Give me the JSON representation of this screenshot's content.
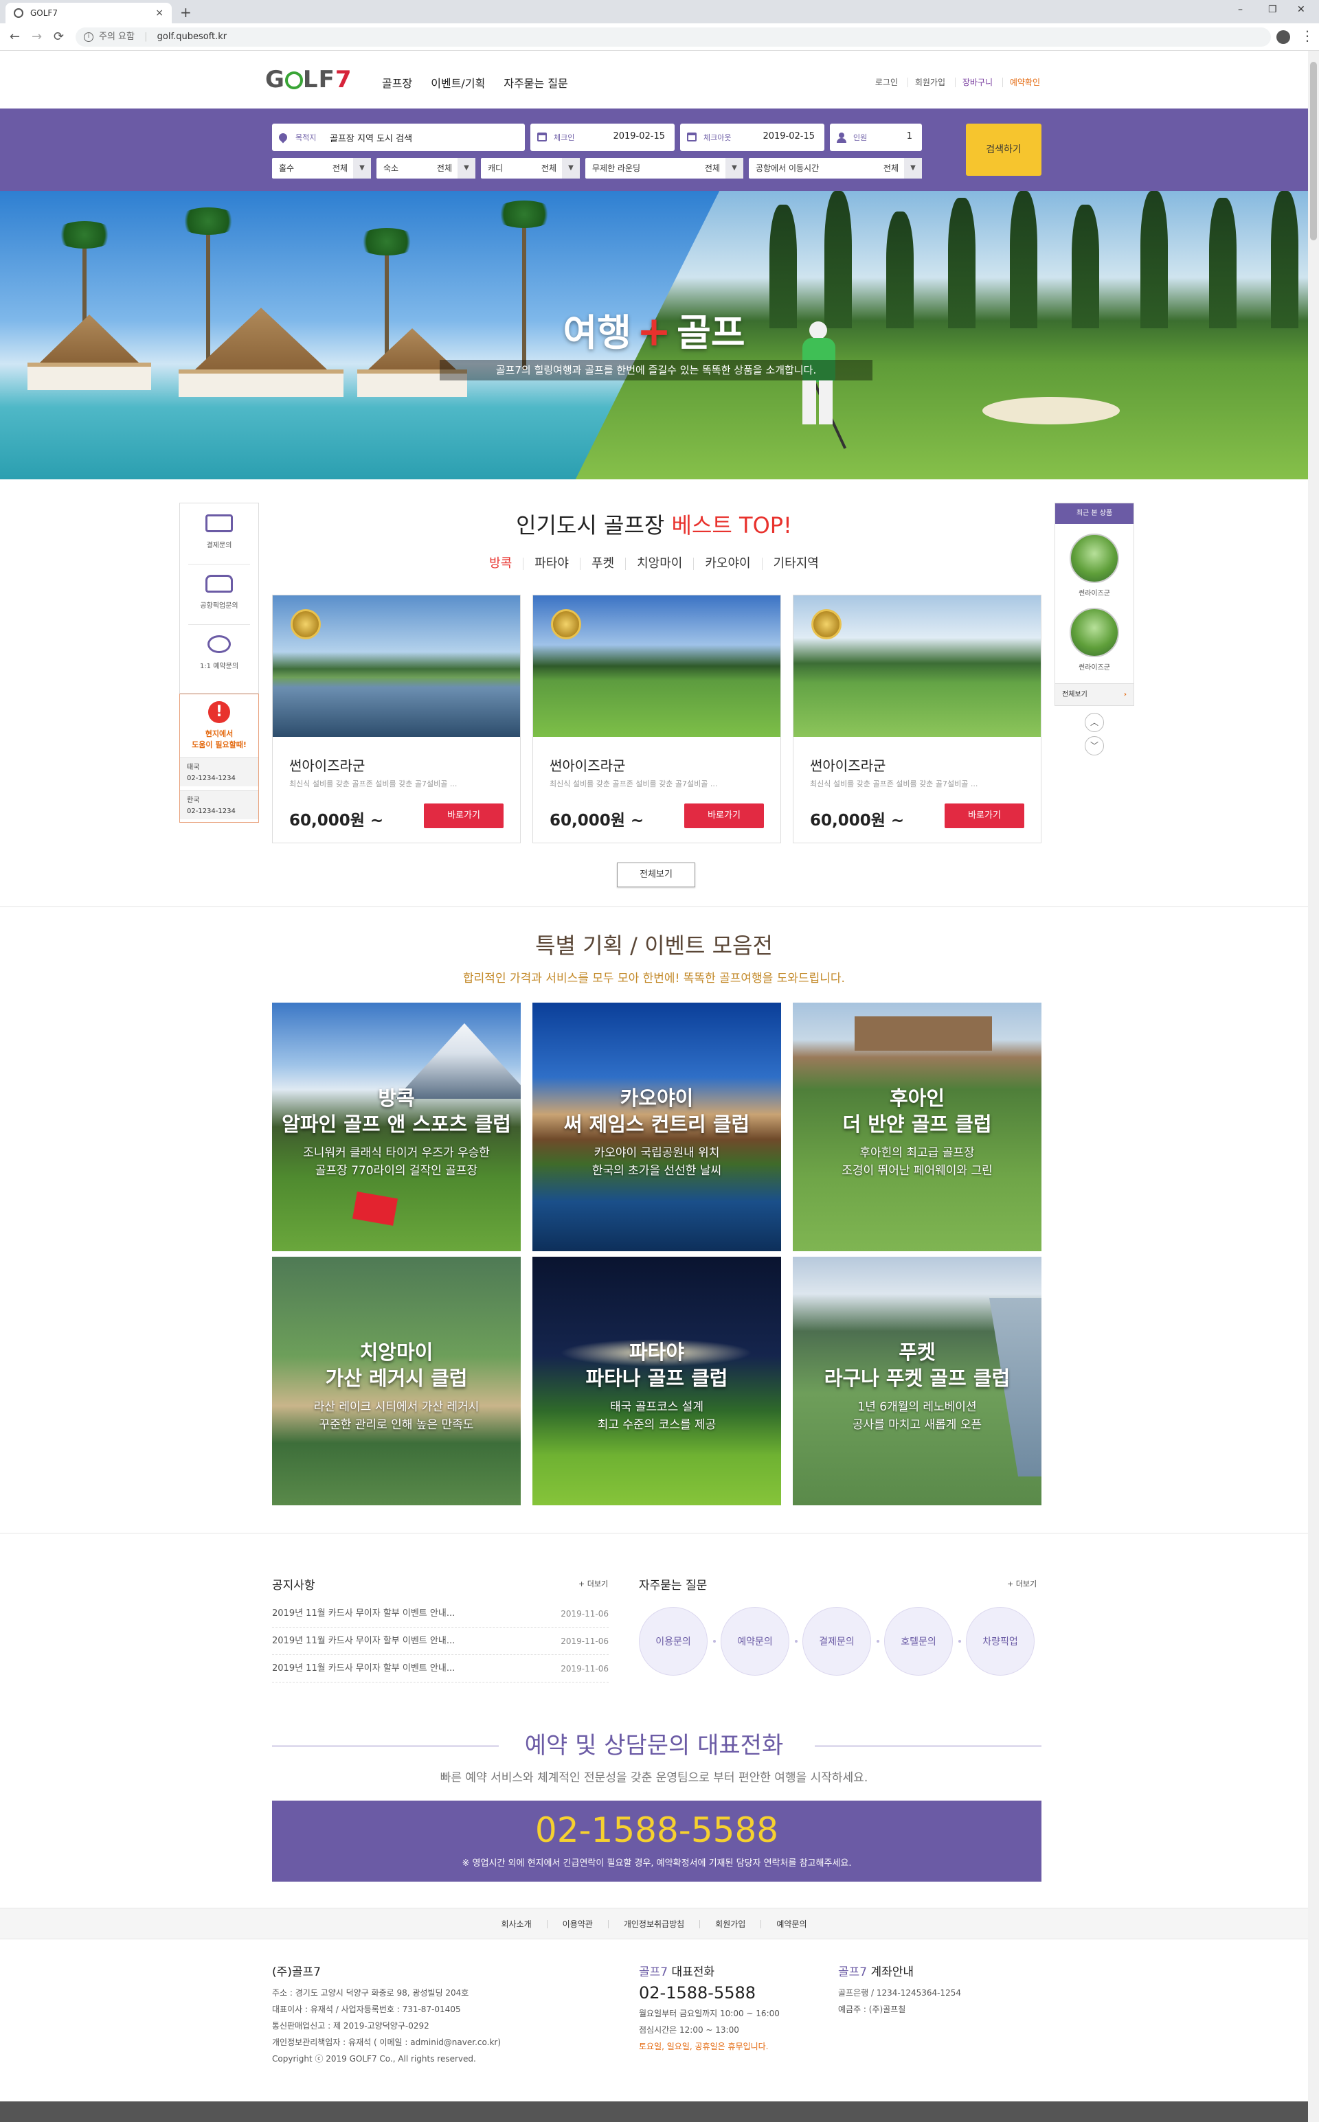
{
  "browser": {
    "tab_title": "GOLF7",
    "close": "×",
    "new_tab": "+",
    "minimize": "–",
    "maximize": "❐",
    "win_close": "✕",
    "back": "←",
    "forward": "→",
    "reload": "⟳",
    "info": "i",
    "security": "주의 요함",
    "separator": "|",
    "url": "golf.qubesoft.kr",
    "menu": "⋮"
  },
  "header": {
    "logo_go": "G",
    "logo_lf": "LF",
    "logo_7": "7",
    "nav": [
      "골프장",
      "이벤트/기획",
      "자주묻는 질문"
    ],
    "util": [
      "로그인",
      "회원가입",
      "장바구니",
      "예약확인"
    ]
  },
  "search": {
    "dest_label": "목적지",
    "dest_placeholder": "골프장 지역 도시 검색",
    "checkin_label": "체크인",
    "checkin": "2019-02-15",
    "checkout_label": "체크아웃",
    "checkout": "2019-02-15",
    "people_label": "인원",
    "people": "1",
    "filters": [
      {
        "k": "홀수",
        "v": "전체"
      },
      {
        "k": "숙소",
        "v": "전체"
      },
      {
        "k": "캐디",
        "v": "전체"
      },
      {
        "k": "무제한 라운딩",
        "v": "전체"
      },
      {
        "k": "공항에서 이동시간",
        "v": "전체"
      }
    ],
    "arrow": "▼",
    "button": "검색하기"
  },
  "hero": {
    "title_a": "여행",
    "plus": "+",
    "title_b": "골프",
    "subtitle": "골프7의 힐링여행과 골프를 한번에 즐길수 있는 똑똑한 상품을 소개합니다."
  },
  "quick": {
    "items": [
      "결제문의",
      "공항픽업문의",
      "1:1 예약문의"
    ],
    "alert": "!",
    "help_line1": "현지에서",
    "help_line2": "도움이 필요할때!",
    "contacts": [
      {
        "country": "태국",
        "phone": "02-1234-1234"
      },
      {
        "country": "한국",
        "phone": "02-1234-1234"
      }
    ]
  },
  "recent": {
    "title": "최근 본 상품",
    "items": [
      "썬라이즈군",
      "썬라이즈군"
    ],
    "all": "전체보기",
    "all_arrow": "›",
    "up": "︿",
    "down": "﹀"
  },
  "best": {
    "title_a": "인기도시 골프장",
    "title_b": "베스트 TOP!",
    "tabs": [
      "방콕",
      "파타야",
      "푸켓",
      "치앙마이",
      "카오야이",
      "기타지역"
    ],
    "cards": [
      {
        "name": "썬아이즈라군",
        "desc": "최신식 설비를 갖춘 골프존 설비를 갖춘 골7설비골 ...",
        "price": "60,000원 ~",
        "button": "바로가기"
      },
      {
        "name": "썬아이즈라군",
        "desc": "최신식 설비를 갖춘 골프존 설비를 갖춘 골7설비골 ...",
        "price": "60,000원 ~",
        "button": "바로가기"
      },
      {
        "name": "썬아이즈라군",
        "desc": "최신식 설비를 갖춘 골프존 설비를 갖춘 골7설비골 ...",
        "price": "60,000원 ~",
        "button": "바로가기"
      }
    ],
    "all_button": "전체보기"
  },
  "events": {
    "title": "특별 기획 / 이벤트 모음전",
    "subtitle": "합리적인 가격과 서비스를 모두 모아 한번에! 똑똑한 골프여행을 도와드립니다.",
    "items": [
      {
        "t1": "방콕",
        "t2": "알파인 골프 앤 스포츠 클럽",
        "d1": "조니워커 클래식 타이거 우즈가 우승한",
        "d2": "골프장 770라이의 걸작인 골프장"
      },
      {
        "t1": "카오야이",
        "t2": "써 제임스 컨트리 클럽",
        "d1": "카오야이 국립공원내 위치",
        "d2": "한국의 초가을 선선한 날씨"
      },
      {
        "t1": "후아인",
        "t2": "더 반얀 골프 클럽",
        "d1": "후아힌의 최고급 골프장",
        "d2": "조경이 뛰어난 페어웨이와 그린"
      },
      {
        "t1": "치앙마이",
        "t2": "가산 레거시 클럽",
        "d1": "라산 레이크 시티에서 가산 레거시",
        "d2": "꾸준한 관리로 인해 높은 만족도"
      },
      {
        "t1": "파타야",
        "t2": "파타나 골프 클럽",
        "d1": "태국 골프코스 설계",
        "d2": "최고 수준의 코스를 제공"
      },
      {
        "t1": "푸켓",
        "t2": "라구나 푸켓 골프 클럽",
        "d1": "1년 6개월의 레노베이션",
        "d2": "공사를 마치고 새롭게 오픈"
      }
    ]
  },
  "notice": {
    "title": "공지사항",
    "more": "+ 더보기",
    "rows": [
      {
        "title": "2019년 11월 카드사 무이자 할부 이벤트 안내...",
        "date": "2019-11-06"
      },
      {
        "title": "2019년 11월 카드사 무이자 할부 이벤트 안내...",
        "date": "2019-11-06"
      },
      {
        "title": "2019년 11월 카드사 무이자 할부 이벤트 안내...",
        "date": "2019-11-06"
      }
    ]
  },
  "faq": {
    "title": "자주묻는 질문",
    "more": "+ 더보기",
    "items": [
      "이용문의",
      "예약문의",
      "결제문의",
      "호텔문의",
      "차량픽업"
    ]
  },
  "contact": {
    "title": "예약 및 상담문의 대표전화",
    "subtitle": "빠른 예약 서비스와 체계적인 전문성을 갖춘 운영팀으로 부터 편안한 여행을 시작하세요.",
    "phone": "02-1588-5588",
    "note": "※ 영업시간 외에 현지에서 긴급연락이 필요할 경우, 예약확정서에 기재된 담당자 연락처를 참고해주세요."
  },
  "footer": {
    "nav": [
      "회사소개",
      "이용약관",
      "개인정보취급방침",
      "회원가입",
      "예약문의"
    ],
    "company": "(주)골프7",
    "lines": [
      "주소 : 경기도 고양시 덕양구 화중로 98, 광성빌딩 204호",
      "대표이사 : 유재석  /  사업자등록번호 : 731-87-01405",
      "통신판매업신고 : 제 2019-고양덕양구-0292",
      "개인정보관리책임자 : 유재석 ( 이메일 : adminid@naver.co.kr)",
      "Copyright ⓒ 2019 GOLF7 Co., All rights reserved."
    ],
    "tel_title_a": "골프7",
    "tel_title_b": "대표전화",
    "tel": "02-1588-5588",
    "tel_hours1": "월요일부터 금요일까지 10:00 ~ 16:00",
    "tel_hours2": "점심시간은 12:00 ~ 13:00",
    "tel_holiday": "토요일, 일요일, 공휴일은 휴무입니다.",
    "acct_title_a": "골프7",
    "acct_title_b": "계좌안내",
    "acct_bank": "골프은행  /  1234-1245364-1254",
    "acct_holder": "예금주 : (주)골프칠"
  },
  "colors": {
    "brand_purple": "#6b5ba5",
    "accent_red": "#e22a42",
    "search_button": "#f6c52e",
    "phone_yellow": "#f6d12f"
  }
}
